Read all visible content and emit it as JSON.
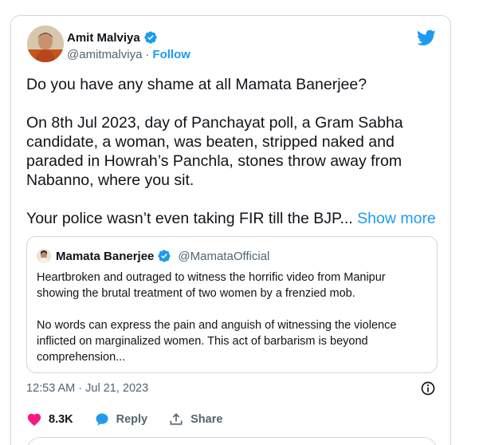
{
  "tweet": {
    "author_name": "Amit Malviya",
    "author_handle": "@amitmalviya",
    "separator": "·",
    "follow_label": "Follow",
    "paragraph1": "Do you have any shame at all Mamata Banerjee?",
    "paragraph2": "On 8th Jul 2023, day of Panchayat poll, a Gram Sabha candidate, a woman, was beaten, stripped naked and paraded in Howrah’s Panchla, stones throw away from Nabanno, where you sit.",
    "paragraph3": "Your police wasn’t even taking FIR till the BJP...",
    "show_more_label": "Show more",
    "timestamp": "12:53 AM · Jul 21, 2023"
  },
  "quote": {
    "author_name": "Mamata Banerjee",
    "author_handle": "@MamataOfficial",
    "paragraph1": "Heartbroken and outraged to witness the horrific video from Manipur showing the brutal treatment of two women by a frenzied mob.",
    "paragraph2": "No words can express the pain and anguish of witnessing the violence inflicted on marginalized women. This act of barbarism is beyond comprehension..."
  },
  "actions": {
    "like_count": "8.3K",
    "reply_label": "Reply",
    "share_label": "Share"
  },
  "colors": {
    "accent": "#1d9bf0",
    "like": "#f91880",
    "text": "#0f1419",
    "muted": "#536471",
    "border": "#cfd9de"
  },
  "icons": [
    "verified-badge-icon",
    "twitter-bird-icon",
    "info-icon",
    "heart-icon",
    "reply-bubble-icon",
    "share-icon"
  ]
}
